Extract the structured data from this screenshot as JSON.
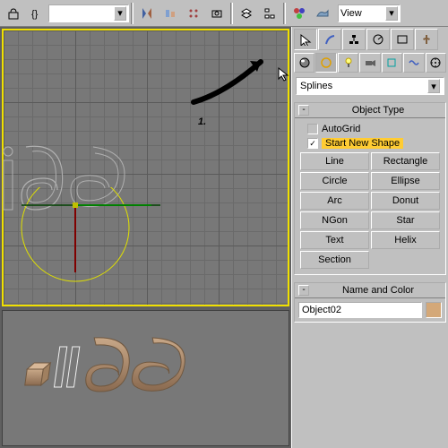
{
  "toolbar": {
    "view_label": "View"
  },
  "panel": {
    "category": "Splines",
    "rollout_objtype": "Object Type",
    "autogrid_label": "AutoGrid",
    "startnew_label": "Start New Shape",
    "buttons": [
      "Line",
      "Rectangle",
      "Circle",
      "Ellipse",
      "Arc",
      "Donut",
      "NGon",
      "Star",
      "Text",
      "Helix",
      "Section",
      ""
    ],
    "rollout_name": "Name and Color",
    "objname": "Object02"
  },
  "annotation": {
    "label": "1."
  },
  "viewport": {
    "text_sample": "ii96"
  }
}
